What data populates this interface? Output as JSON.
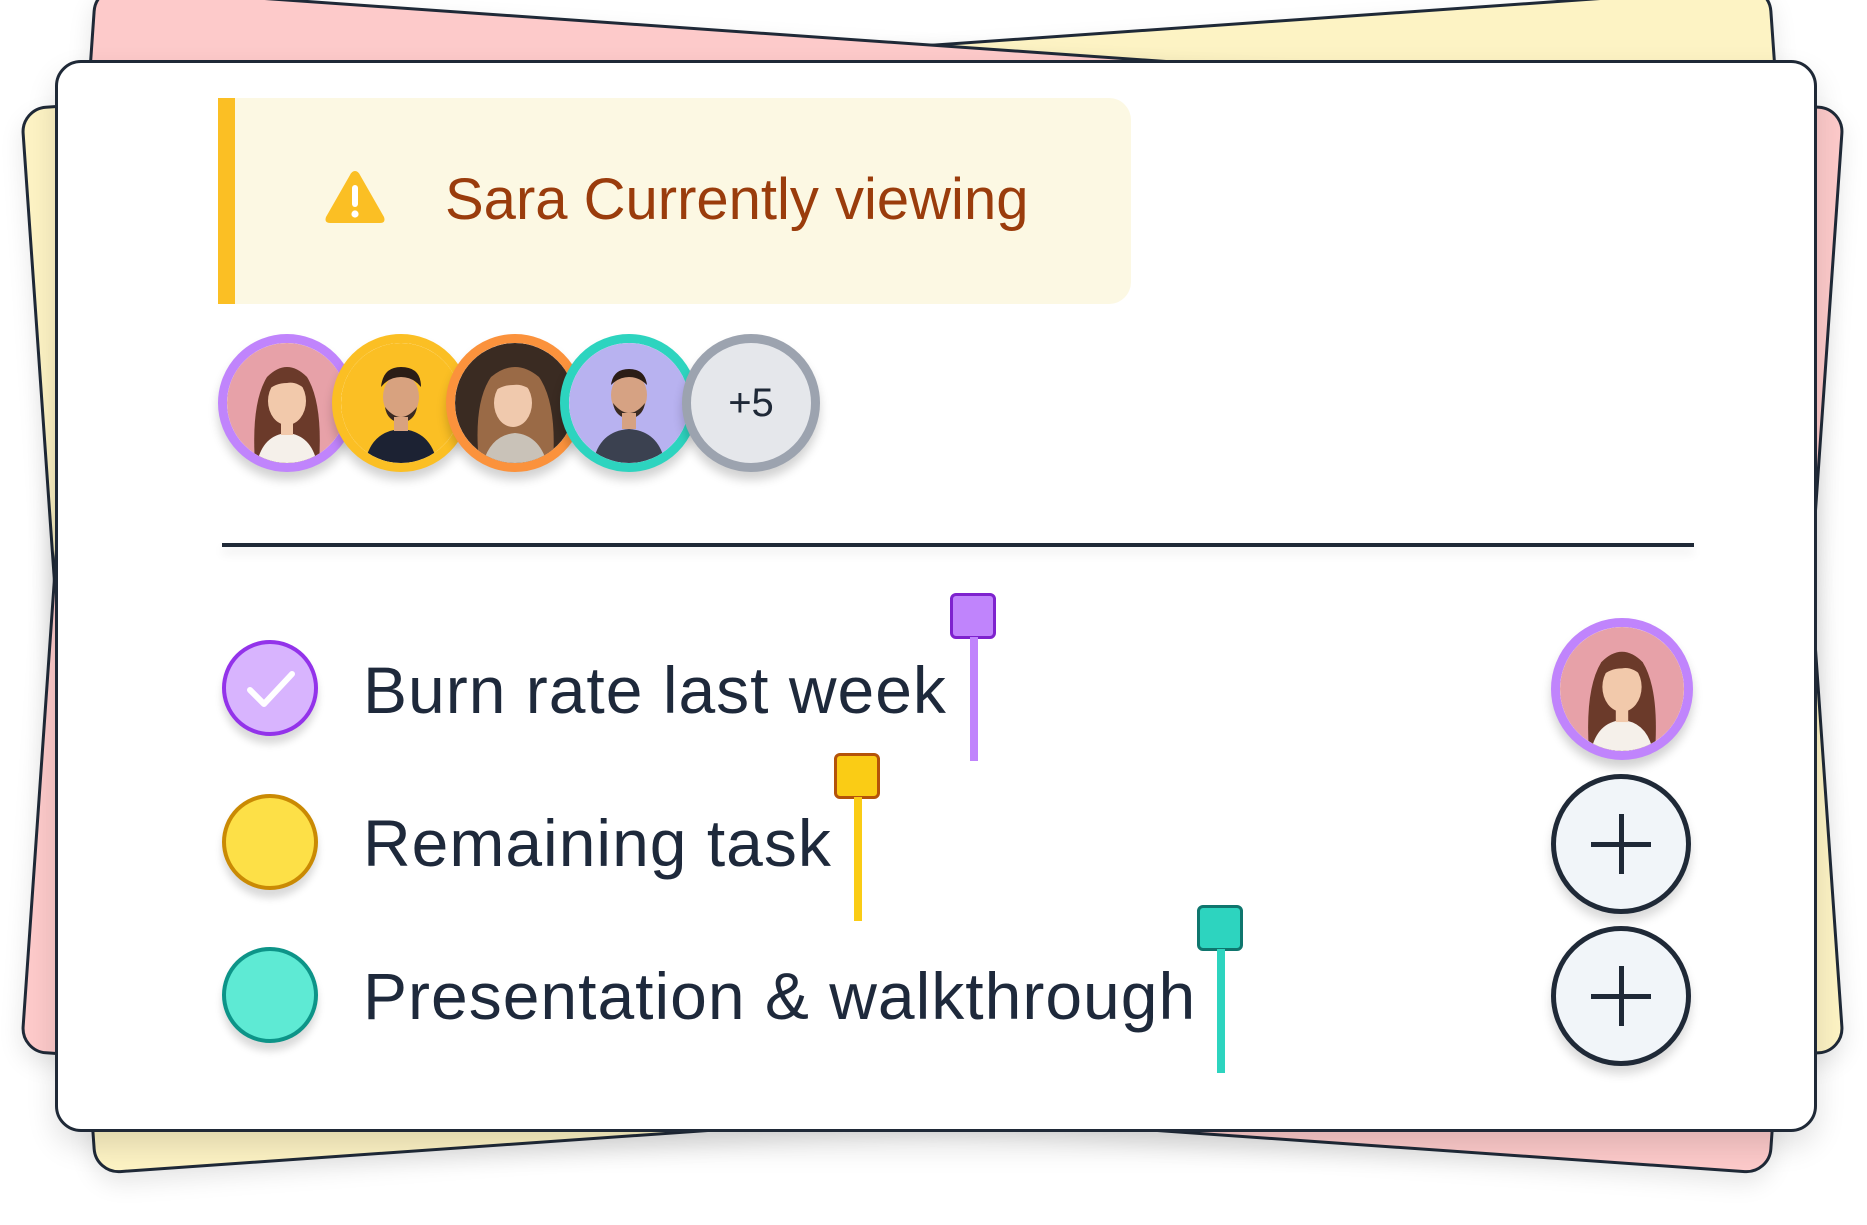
{
  "alert": {
    "icon": "warning-icon",
    "text": "Sara Currently viewing",
    "accent_color": "#fbbf24",
    "text_color": "#9a3c0c"
  },
  "viewers": {
    "avatars": [
      {
        "name": "avatar-woman-1",
        "ring_color": "#c084fc"
      },
      {
        "name": "avatar-man-1",
        "ring_color": "#fbbf24"
      },
      {
        "name": "avatar-woman-2",
        "ring_color": "#fb923c"
      },
      {
        "name": "avatar-man-2",
        "ring_color": "#2dd4bf"
      }
    ],
    "more_label": "+5"
  },
  "tasks": [
    {
      "label": "Burn rate last week",
      "dot_color": "#d8b4fe",
      "border_color": "#9333ea",
      "checked": true,
      "flag_color": "#c084fc",
      "assignee": "avatar-woman-1"
    },
    {
      "label": "Remaining task",
      "dot_color": "#fde047",
      "border_color": "#ca8a04",
      "checked": false,
      "flag_color": "#facc15",
      "assignee": null
    },
    {
      "label": "Presentation & walkthrough",
      "dot_color": "#5eead4",
      "border_color": "#0d9488",
      "checked": false,
      "flag_color": "#2dd4bf",
      "assignee": null
    }
  ],
  "actions": {
    "add_icon": "plus-icon"
  }
}
